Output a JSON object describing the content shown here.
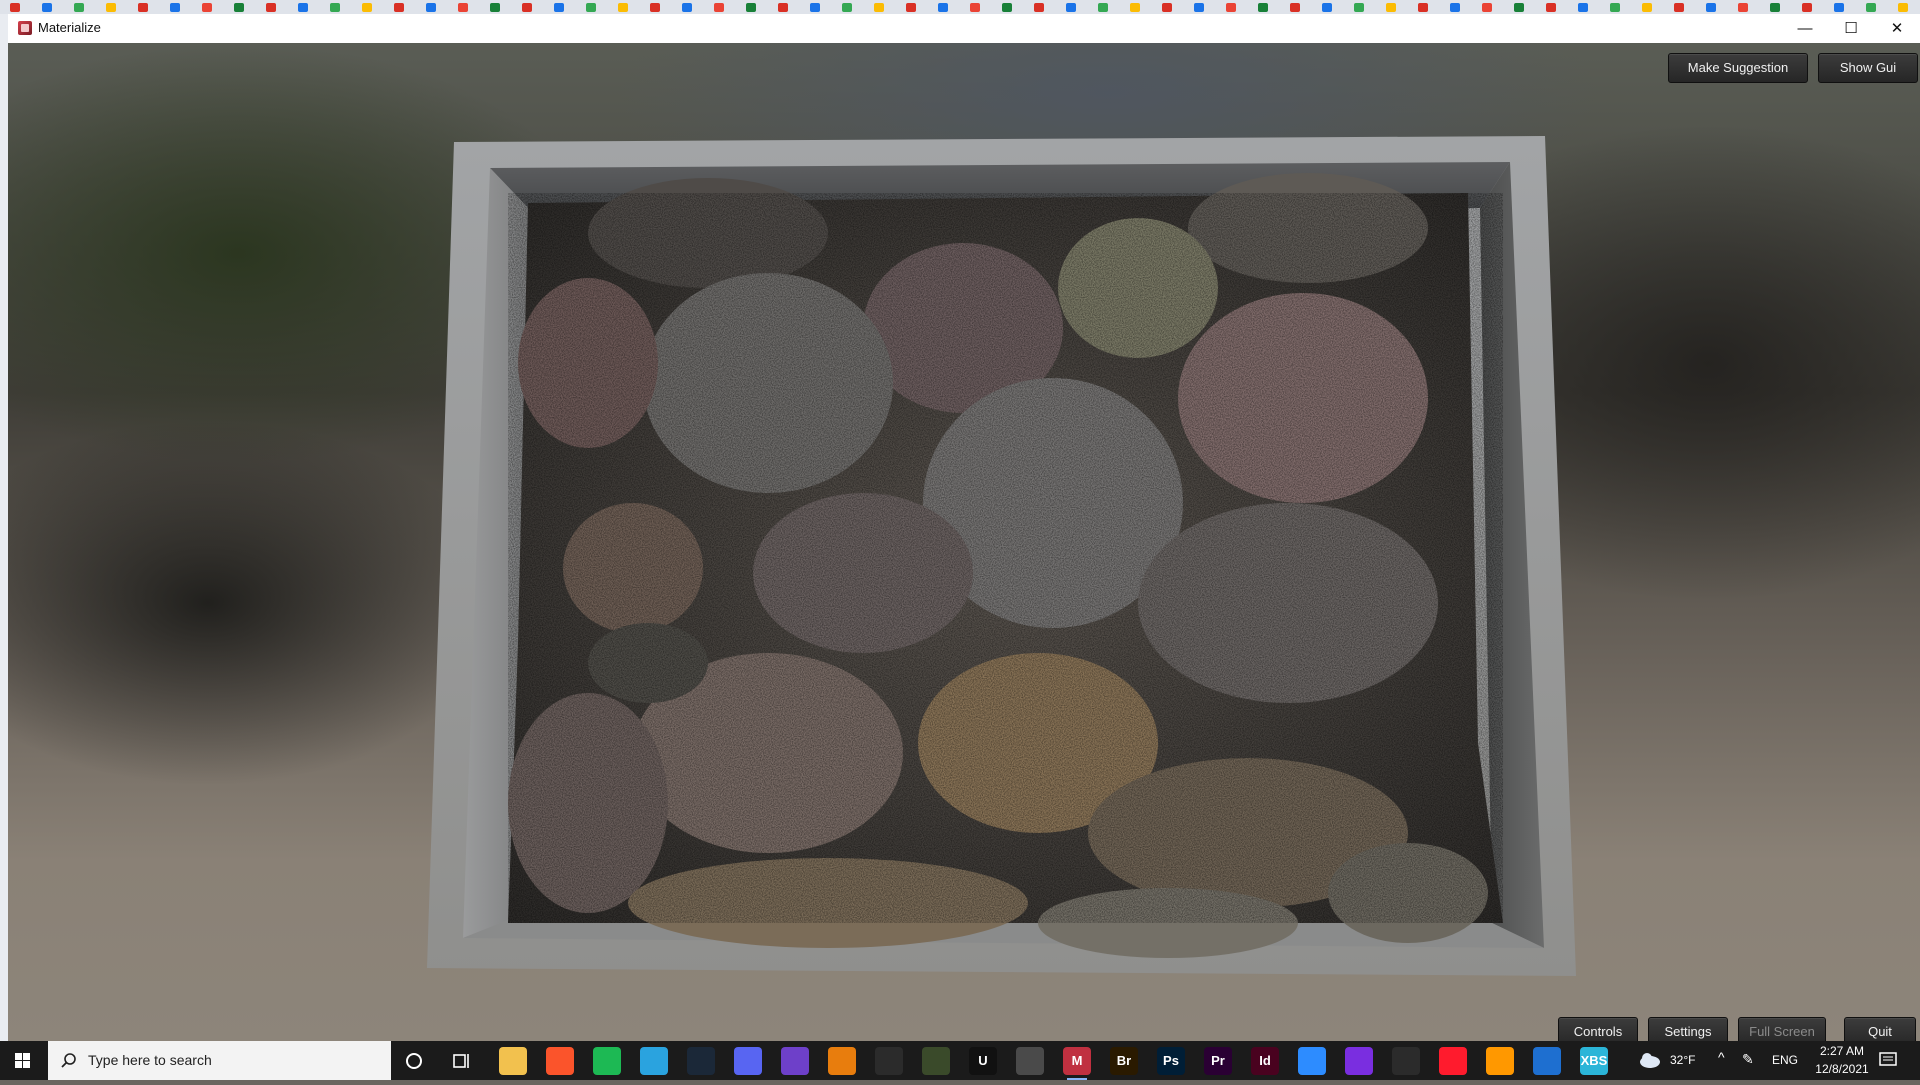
{
  "window": {
    "title": "Materialize",
    "controls": {
      "minimize": "—",
      "maximize": "☐",
      "close": "✕"
    }
  },
  "viewport": {
    "top_buttons": {
      "make_suggestion": "Make Suggestion",
      "show_gui": "Show Gui"
    },
    "bottom_buttons": {
      "controls": "Controls",
      "settings": "Settings",
      "full_screen": "Full Screen",
      "quit": "Quit"
    }
  },
  "taskbar": {
    "search_placeholder": "Type here to search",
    "pinned": [
      {
        "name": "File Explorer",
        "label": "",
        "color": "#f2c14e"
      },
      {
        "name": "Brave",
        "label": "",
        "color": "#fb542b"
      },
      {
        "name": "Spotify",
        "label": "",
        "color": "#1db954"
      },
      {
        "name": "Telegram",
        "label": "",
        "color": "#2aa3df"
      },
      {
        "name": "Steam",
        "label": "",
        "color": "#1b2838"
      },
      {
        "name": "Discord",
        "label": "",
        "color": "#5865f2"
      },
      {
        "name": "GitHub Desktop",
        "label": "",
        "color": "#6e40c9"
      },
      {
        "name": "Blender",
        "label": "",
        "color": "#e87d0d"
      },
      {
        "name": "Visual Studio",
        "label": "",
        "color": "#2b2b2b"
      },
      {
        "name": "Substance",
        "label": "",
        "color": "#3a4a2a"
      },
      {
        "name": "Unreal Engine",
        "label": "U",
        "color": "#111111"
      },
      {
        "name": "Chrome Canary",
        "label": "",
        "color": "#4a4a4a"
      },
      {
        "name": "Materialize",
        "label": "M",
        "color": "#c03040"
      },
      {
        "name": "Bridge",
        "label": "Br",
        "color": "#2a1a00"
      },
      {
        "name": "Photoshop",
        "label": "Ps",
        "color": "#001e36"
      },
      {
        "name": "Premiere Pro",
        "label": "Pr",
        "color": "#2a0033"
      },
      {
        "name": "InDesign",
        "label": "Id",
        "color": "#49021f"
      },
      {
        "name": "Zoom",
        "label": "",
        "color": "#2d8cff"
      },
      {
        "name": "Podcast",
        "label": "",
        "color": "#7a2ee0"
      },
      {
        "name": "Library",
        "label": "",
        "color": "#2b2b2b"
      },
      {
        "name": "Opera",
        "label": "",
        "color": "#ff1b2d"
      },
      {
        "name": "Sublime",
        "label": "",
        "color": "#ff9800"
      },
      {
        "name": "Edge",
        "label": "",
        "color": "#1e6fd0"
      },
      {
        "name": "XBS",
        "label": "XBS",
        "color": "#2bb5d8"
      }
    ],
    "tray": {
      "temperature": "32°F",
      "language": "ENG",
      "time": "2:27 AM",
      "date": "12/8/2021"
    }
  }
}
